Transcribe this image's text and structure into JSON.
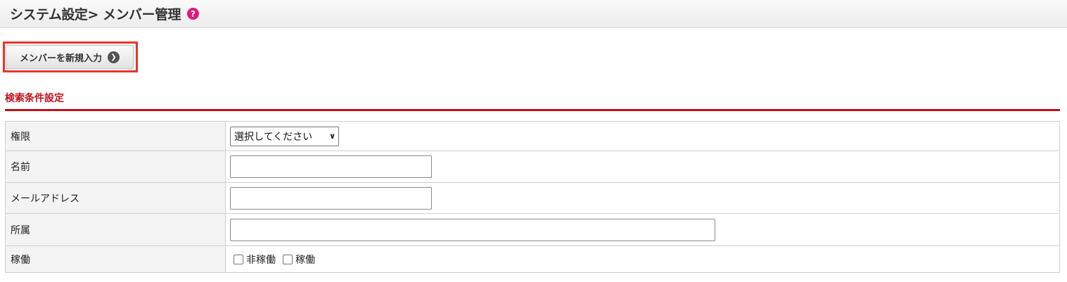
{
  "header": {
    "title": "システム設定> メンバー管理",
    "help_icon_glyph": "?"
  },
  "actions": {
    "new_member_label": "メンバーを新規入力",
    "new_member_icon": "arrow-right-circle-icon"
  },
  "search": {
    "section_title": "検索条件設定",
    "rows": {
      "role": {
        "label": "権限",
        "select_value": "選択してください"
      },
      "name": {
        "label": "名前",
        "value": ""
      },
      "email": {
        "label": "メールアドレス",
        "value": ""
      },
      "dept": {
        "label": "所属",
        "value": ""
      },
      "status": {
        "label": "稼働",
        "options": [
          {
            "label": "非稼働",
            "checked": false
          },
          {
            "label": "稼働",
            "checked": false
          }
        ]
      }
    }
  },
  "colors": {
    "accent": "#c2101a",
    "help_icon": "#e0197d",
    "highlight": "#e8342a"
  }
}
